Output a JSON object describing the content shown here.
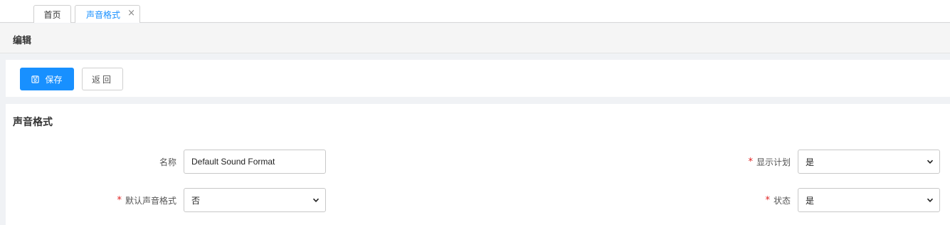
{
  "tabs": [
    {
      "label": "首页"
    },
    {
      "label": "声音格式",
      "close": "×"
    }
  ],
  "header": {
    "title": "编辑"
  },
  "toolbar": {
    "save_label": "保存",
    "back_label": "返回"
  },
  "section": {
    "title": "声音格式"
  },
  "form": {
    "name": {
      "label": "名称",
      "value": "Default Sound Format"
    },
    "default_format": {
      "label": "默认声音格式",
      "required": "*",
      "value": "否"
    },
    "show_plan": {
      "label": "显示计划",
      "required": "*",
      "value": "是"
    },
    "status": {
      "label": "状态",
      "required": "*",
      "value": "是"
    }
  },
  "colors": {
    "accent": "#1890ff",
    "required": "#e02020"
  }
}
